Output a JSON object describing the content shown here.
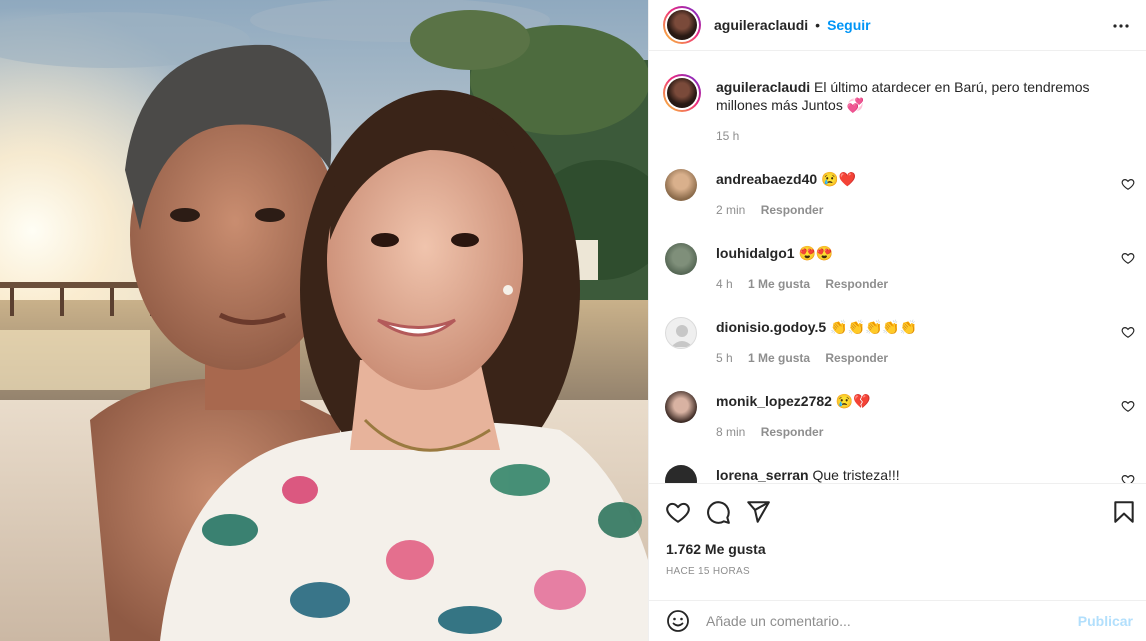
{
  "post": {
    "author": "aguileraclaudi",
    "follow_label": "Seguir",
    "separator": "•",
    "caption": "El último atardecer en Barú, pero tendremos millones más Juntos 💞",
    "caption_time": "15 h"
  },
  "comments": [
    {
      "username": "andreabaezd40",
      "text": "😢❤️",
      "time": "2 min",
      "likes": "",
      "reply": "Responder"
    },
    {
      "username": "louhidalgo1",
      "text": "😍😍",
      "time": "4 h",
      "likes": "1 Me gusta",
      "reply": "Responder"
    },
    {
      "username": "dionisio.godoy.5",
      "text": "👏👏👏👏👏",
      "time": "5 h",
      "likes": "1 Me gusta",
      "reply": "Responder"
    },
    {
      "username": "monik_lopez2782",
      "text": "😢💔",
      "time": "8 min",
      "likes": "",
      "reply": "Responder"
    },
    {
      "username": "lorena_serran",
      "text": "Que tristeza!!!",
      "time": "",
      "likes": "",
      "reply": ""
    }
  ],
  "stats": {
    "likes": "1.762 Me gusta",
    "ago": "HACE 15 HORAS"
  },
  "composer": {
    "placeholder": "Añade un comentario...",
    "publish": "Publicar"
  },
  "icons": [
    "more-icon",
    "heart-icon",
    "comment-icon",
    "share-icon",
    "bookmark-icon",
    "emoji-icon"
  ],
  "colors": {
    "accent": "#0095f6",
    "publish_disabled": "#b2dffc",
    "muted": "#8e8e8e"
  }
}
